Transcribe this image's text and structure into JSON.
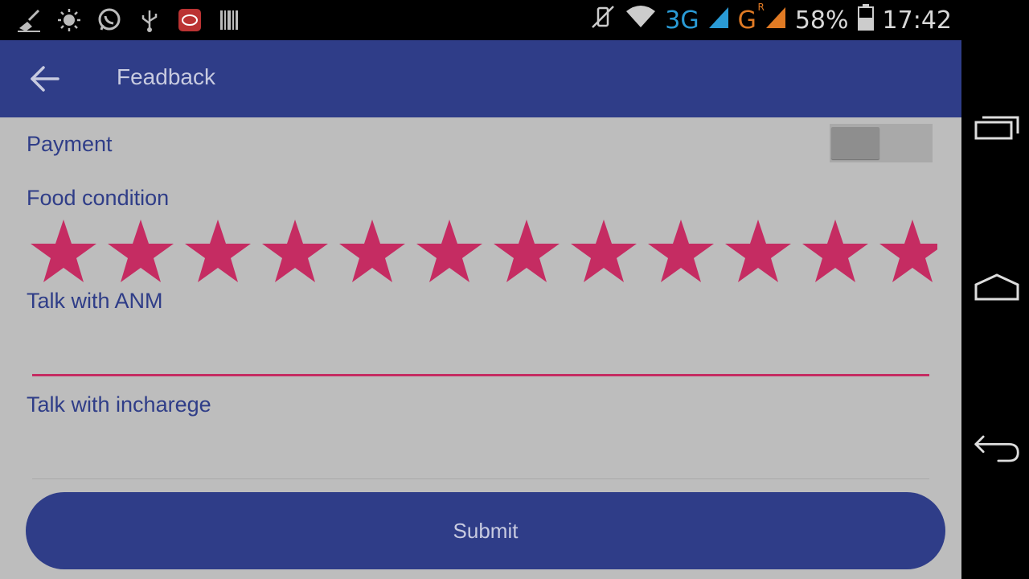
{
  "status_bar": {
    "battery": "58%",
    "time": "17:42",
    "network_3g": "3G",
    "network_g": "G",
    "roaming": "R",
    "icons_left": [
      "broom-icon",
      "brightness-icon",
      "whatsapp-icon",
      "usb-icon",
      "app-notification-icon",
      "barcode-icon"
    ],
    "icons_right": [
      "vibrate-off-icon",
      "wifi-icon",
      "signal-3g-icon",
      "signal-g-icon",
      "battery-icon"
    ]
  },
  "toolbar": {
    "title": "Feadback",
    "back_icon": "arrow-left-icon"
  },
  "form": {
    "payment_label": "Payment",
    "payment_switch_on": false,
    "food_label": "Food condition",
    "food_rating": 12,
    "food_rating_max": 12,
    "talk_anm_label": "Talk with ANM",
    "talk_anm_value": "",
    "talk_incharge_label": "Talk with incharege",
    "talk_incharge_value": ""
  },
  "submit_label": "Submit",
  "colors": {
    "primary": "#2f3d88",
    "accent": "#c52c62",
    "background_dimmed": "#bdbdbd"
  },
  "nav_bar": {
    "buttons": [
      "recent-apps-icon",
      "home-icon",
      "back-icon"
    ]
  }
}
